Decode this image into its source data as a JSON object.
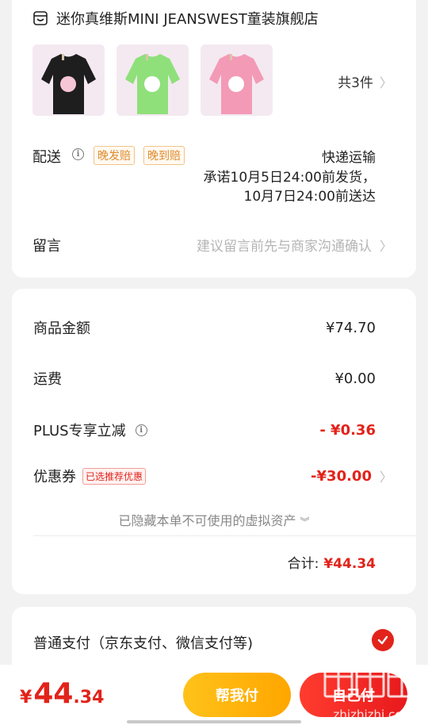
{
  "store": {
    "name": "迷你真维斯MINI JEANSWEST童装旗舰店",
    "icon": "store-icon",
    "products": [
      {
        "color": "#1e1e1e",
        "name": "black-shirt"
      },
      {
        "color": "#8fe07b",
        "name": "green-shirt"
      },
      {
        "color": "#f39ab6",
        "name": "pink-shirt"
      }
    ],
    "count_label": "共3件"
  },
  "shipping": {
    "label": "配送",
    "tag_late_ship": "晚发赔",
    "tag_late_arrive": "晚到赔",
    "method": "快递运输",
    "promise_line1": "承诺10月5日24:00前发货，",
    "promise_line2": "10月7日24:00前送达"
  },
  "message": {
    "label": "留言",
    "placeholder": "建议留言前先与商家沟通确认"
  },
  "prices": {
    "goods_label": "商品金额",
    "goods_value": "¥74.70",
    "shipping_label": "运费",
    "shipping_value": "¥0.00",
    "plus_label": "PLUS专享立减",
    "plus_value": "- ¥0.36",
    "coupon_label": "优惠券",
    "coupon_tag": "已选推荐优惠",
    "coupon_value": "-¥30.00",
    "hidden_assets": "已隐藏本单不可使用的虚拟资产",
    "total_label": "合计:",
    "total_value": "¥44.34"
  },
  "payment": {
    "method_label": "普通支付（京东支付、微信支付等)"
  },
  "bottom": {
    "currency": "¥",
    "amount_int": "44",
    "amount_dec": ".34",
    "help_pay": "帮我付",
    "self_pay": "自己付"
  },
  "watermark": {
    "site": "zhizhizhi.com"
  },
  "colors": {
    "accent_red": "#e2231a",
    "help_yellow": "#ffb40d",
    "tag_orange": "#e08a2b"
  }
}
